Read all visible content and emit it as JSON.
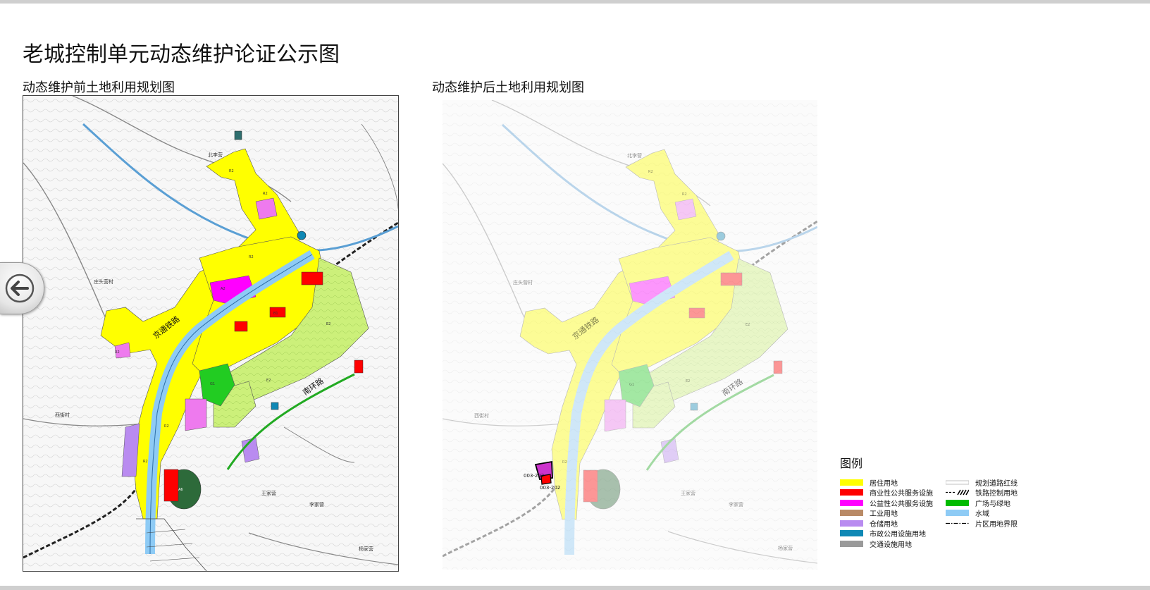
{
  "page": {
    "title": "老城控制单元动态维护论证公示图"
  },
  "maps": [
    {
      "title": "动态维护前土地利用规划图",
      "place_labels": [
        "北李营",
        "庄头营村",
        "西街村",
        "王家营",
        "李家营",
        "杨家营"
      ],
      "road_labels": [
        "京通铁路",
        "南环路"
      ],
      "zone_codes": [
        "R2",
        "R2",
        "R2",
        "A2",
        "B1",
        "E2",
        "E2",
        "G1",
        "R2",
        "A6",
        "R2",
        "R2"
      ]
    },
    {
      "title": "动态维护后土地利用规划图",
      "place_labels": [
        "北李营",
        "庄头营村",
        "西街村",
        "王家营",
        "李家营",
        "杨家营"
      ],
      "road_labels": [
        "京通铁路",
        "南环路"
      ],
      "zone_codes": [
        "R2",
        "R2",
        "E2",
        "E2",
        "G1",
        "R2"
      ],
      "highlight_labels": [
        "003-202",
        "003-202"
      ]
    }
  ],
  "legend": {
    "title": "图例",
    "items": [
      {
        "label": "居住用地",
        "type": "fill",
        "color": "#ffff00"
      },
      {
        "label": "规划道路红线",
        "type": "thin-line"
      },
      {
        "label": "商业性公共服务设施",
        "type": "fill",
        "color": "#ff0000"
      },
      {
        "label": "铁路控制用地",
        "type": "rail"
      },
      {
        "label": "公益性公共服务设施",
        "type": "fill",
        "color": "#ff00ff"
      },
      {
        "label": "广场与绿地",
        "type": "fill",
        "color": "#00bb00"
      },
      {
        "label": "工业用地",
        "type": "fill",
        "color": "#b98a66"
      },
      {
        "label": "水域",
        "type": "fill",
        "color": "#8ecbf5"
      },
      {
        "label": "仓储用地",
        "type": "fill",
        "color": "#b98bf0"
      },
      {
        "label": "片区用地界限",
        "type": "dashdot"
      },
      {
        "label": "市政公用设施用地",
        "type": "fill",
        "color": "#0f88b5"
      },
      {
        "label": "",
        "type": "none"
      },
      {
        "label": "交通设施用地",
        "type": "fill",
        "color": "#9a9a9a"
      }
    ]
  },
  "colors": {
    "residential": "#ffff00",
    "commercial": "#ff0000",
    "public": "#ff00ff",
    "green": "#00bb00",
    "light_green": "#ccf07a",
    "water": "#8ecbf5",
    "storage": "#b98bf0",
    "utility": "#0f88b5",
    "industrial": "#b98a66",
    "transport": "#9a9a9a"
  }
}
